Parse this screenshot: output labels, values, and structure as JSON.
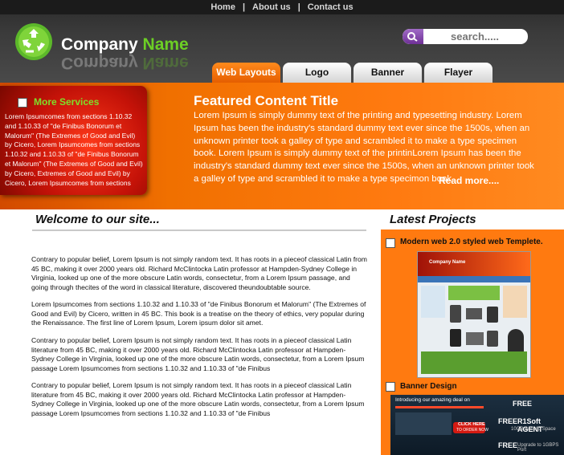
{
  "nav": {
    "home": "Home",
    "about": "About us",
    "contact": "Contact us",
    "sep": "|"
  },
  "brand": {
    "company": "Company",
    "name": "Name"
  },
  "search": {
    "placeholder": "search....."
  },
  "tabs": [
    "Web Layouts",
    "Logo",
    "Banner",
    "Flayer"
  ],
  "services": {
    "title": "More Services",
    "text": "Lorem Ipsumcomes from sections 1.10.32 and 1.10.33 of \"de Finibus Bonorum et Malorum\" (The Extremes of Good and Evil) by Cicero, Lorem Ipsumcomes from sections 1.10.32 and 1.10.33 of \"de Finibus Bonorum et Malorum\" (The Extremes of Good and Evil) by Cicero, Extremes of Good and Evil) by Cicero, Lorem Ipsumcomes from sections"
  },
  "featured": {
    "title": "Featured Content Title",
    "text": "Lorem Ipsum is simply dummy text of the printing and typesetting industry. Lorem Ipsum has been the industry's standard dummy text ever since the 1500s, when an unknown printer took a galley of type and scrambled it to make a type specimen book. Lorem Ipsum is simply dummy text of the printinLorem Ipsum has been the industry's standard dummy text ever since the 1500s, when an unknown printer took a galley of type and scrambled it to make a type specimon book.",
    "read_more": "Read more...."
  },
  "welcome": {
    "title": "Welcome to our site...",
    "paragraphs": [
      "Contrary to popular belief, Lorem Ipsum is not simply random text. It has roots in a pieceof classical Latin from 45 BC, making it over 2000 years old. Richard McClintocka Latin professor at Hampden-Sydney College in Virginia, looked up one of the more obscure Latin words, consectetur, from a Lorem Ipsum passage, and going through thecites of the word in classical literature, discovered theundoubtable source.",
      "Lorem Ipsumcomes from sections 1.10.32 and 1.10.33 of \"de Finibus Bonorum et Malorum\" (The Extremes of Good and Evil) by Cicero, written in 45 BC. This book is a treatise on the theory of ethics, very popular during the Renaissance. The first line of Lorem Ipsum, Lorem ipsum dolor sit amet.",
      "Contrary to popular belief, Lorem Ipsum is not simply random text. It has roots in a pieceof classical Latin literature from 45 BC, making it over 2000 years old. Richard McClintocka Latin professor at Hampden-Sydney College in Virginia, looked up one of the more obscure Latin words, consectetur, from a Lorem Ipsum passage Lorem Ipsumcomes from sections 1.10.32 and 1.10.33 of \"de Finibus",
      "Contrary to popular belief, Lorem Ipsum is not simply random text. It has roots in a pieceof classical Latin literature from 45 BC, making it over 2000 years old. Richard McClintocka Latin professor at Hampden-Sydney College in Virginia, looked up one of the more obscure Latin words, consectetur, from a Lorem Ipsum passage Lorem Ipsumcomes from sections 1.10.32 and 1.10.33 of \"de Finibus"
    ]
  },
  "latest": {
    "title": "Latest Projects",
    "items": [
      {
        "title": "Modern web 2.0 styled web Templete."
      },
      {
        "title": "Banner Design"
      }
    ],
    "thumb1": {
      "company": "Company Name"
    },
    "thumb2": {
      "line1": "Introducing our amazing deal on",
      "free1": "FREE",
      "click": "CLICK HERE",
      "order": "TO ORDER NOW",
      "free2": "FREE",
      "agent": "R1Soft AGENT",
      "backup": "10GB Backup Space",
      "free3": "FREE",
      "upgrade": "Upgrade to 1GBPS Port"
    }
  },
  "colors": {
    "accent": "#f07000",
    "green": "#6ccf25",
    "dark": "#2a2a2a"
  }
}
